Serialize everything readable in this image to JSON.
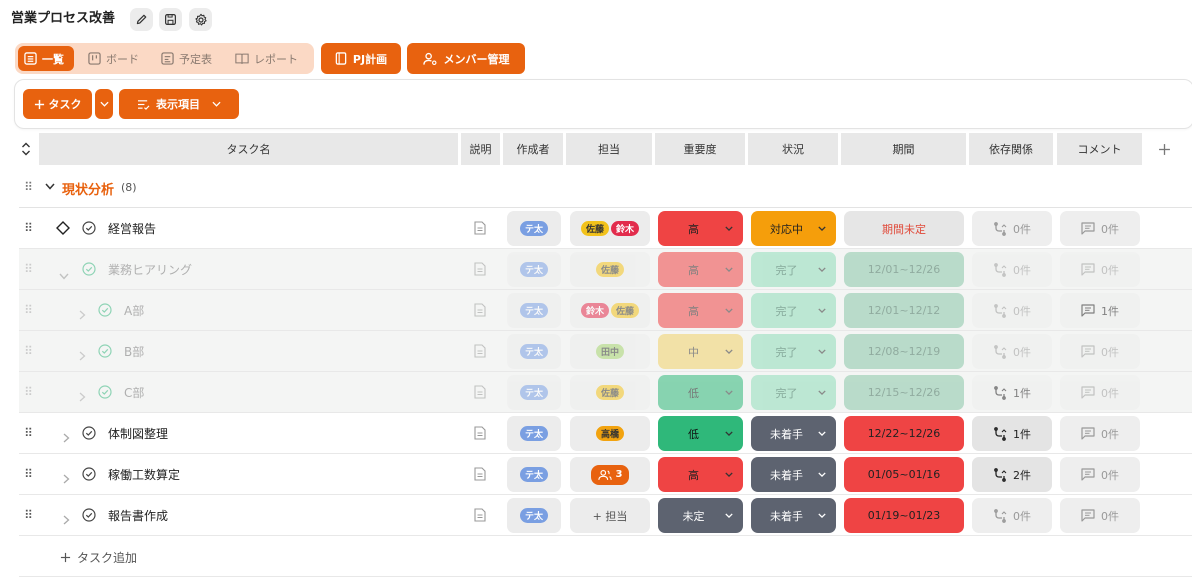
{
  "project": {
    "title": "営業プロセス改善"
  },
  "view_tabs": [
    {
      "label": "一覧",
      "icon": "list-icon",
      "active": true
    },
    {
      "label": "ボード",
      "icon": "board-icon",
      "active": false
    },
    {
      "label": "予定表",
      "icon": "calendar-icon",
      "active": false
    },
    {
      "label": "レポート",
      "icon": "book-icon",
      "active": false
    }
  ],
  "actions": {
    "pj_plan": "PJ計画",
    "member_management": "メンバー管理"
  },
  "toolbar": {
    "add_task": "タスク",
    "display_items": "表示項目"
  },
  "columns": {
    "task_name": "タスク名",
    "description": "説明",
    "creator": "作成者",
    "assignee": "担当",
    "priority": "重要度",
    "status": "状況",
    "period": "期間",
    "dependency": "依存関係",
    "comment": "コメント"
  },
  "group": {
    "name": "現状分析",
    "count": "(8)"
  },
  "tasks": [
    {
      "name": "経営報告",
      "creator": "テ太",
      "assignees": [
        "佐藤",
        "鈴木"
      ],
      "priority": "高",
      "status": "対応中",
      "period": "期間未定",
      "dependency": "0件",
      "comment": "0件"
    },
    {
      "name": "業務ヒアリング",
      "creator": "テ太",
      "assignees": [
        "佐藤"
      ],
      "priority": "高",
      "status": "完了",
      "period": "12/01~12/26",
      "dependency": "0件",
      "comment": "0件"
    },
    {
      "name": "A部",
      "creator": "テ太",
      "assignees": [
        "鈴木",
        "佐藤"
      ],
      "priority": "高",
      "status": "完了",
      "period": "12/01~12/12",
      "dependency": "0件",
      "comment": "1件"
    },
    {
      "name": "B部",
      "creator": "テ太",
      "assignees": [
        "田中"
      ],
      "priority": "中",
      "status": "完了",
      "period": "12/08~12/19",
      "dependency": "0件",
      "comment": "0件"
    },
    {
      "name": "C部",
      "creator": "テ太",
      "assignees": [
        "佐藤"
      ],
      "priority": "低",
      "status": "完了",
      "period": "12/15~12/26",
      "dependency": "1件",
      "comment": "0件"
    },
    {
      "name": "体制図整理",
      "creator": "テ太",
      "assignees": [
        "高橋"
      ],
      "priority": "低",
      "status": "未着手",
      "period": "12/22~12/26",
      "dependency": "1件",
      "comment": "0件"
    },
    {
      "name": "稼働工数算定",
      "creator": "テ太",
      "assignee_count": "3",
      "priority": "高",
      "status": "未着手",
      "period": "01/05~01/16",
      "dependency": "2件",
      "comment": "0件"
    },
    {
      "name": "報告書作成",
      "creator": "テ太",
      "assignee_placeholder": "+ 担当",
      "priority": "未定",
      "status": "未着手",
      "period": "01/19~01/23",
      "dependency": "0件",
      "comment": "0件"
    }
  ],
  "add_task_row": "タスク追加",
  "colors": {
    "accent": "#e8620f",
    "priority_high": "#ef4444",
    "priority_mid": "#f2d26a",
    "priority_low": "#2fb87a",
    "priority_unset": "#5d6370",
    "status_in_progress": "#f59e0b",
    "status_done": "#8fdcb9",
    "status_not_started": "#5d6370",
    "period_overdue": "#ef4444",
    "period_done": "#8ac7a8"
  }
}
